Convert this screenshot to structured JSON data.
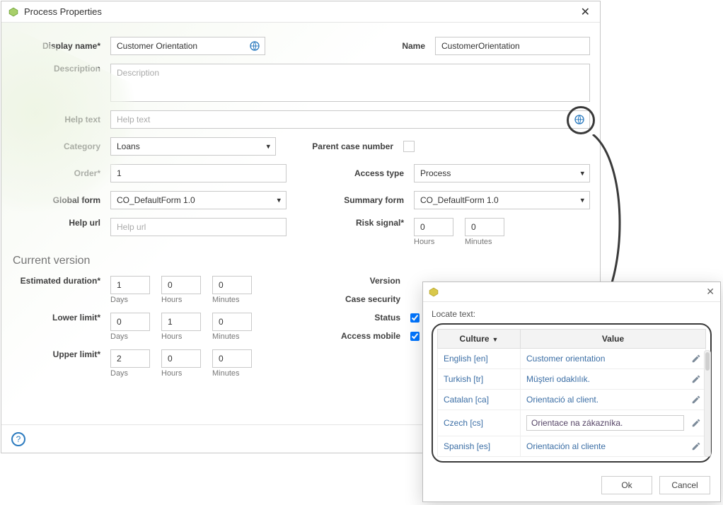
{
  "window": {
    "title": "Process Properties",
    "close_glyph": "✕"
  },
  "labels": {
    "display_name": "Display name*",
    "name": "Name",
    "description": "Description",
    "help_text": "Help text",
    "category": "Category",
    "parent_case": "Parent case number",
    "order": "Order*",
    "access_type": "Access type",
    "global_form": "Global form",
    "summary_form": "Summary form",
    "help_url": "Help url",
    "risk_signal": "Risk signal*",
    "hours": "Hours",
    "minutes": "Minutes",
    "days": "Days",
    "section_current_version": "Current version",
    "est_duration": "Estimated duration*",
    "lower_limit": "Lower limit*",
    "upper_limit": "Upper limit*",
    "version": "Version",
    "case_security": "Case security",
    "status": "Status",
    "access_mobile": "Access mobile"
  },
  "values": {
    "display_name": "Customer Orientation",
    "name": "CustomerOrientation",
    "description_ph": "Description",
    "help_text_ph": "Help text",
    "category": "Loans",
    "order": "1",
    "access_type": "Process",
    "global_form": "CO_DefaultForm 1.0",
    "summary_form": "CO_DefaultForm 1.0",
    "help_url_ph": "Help url",
    "risk_hours": "0",
    "risk_minutes": "0",
    "est_days": "1",
    "est_hours": "0",
    "est_minutes": "0",
    "low_days": "0",
    "low_hours": "1",
    "low_minutes": "0",
    "up_days": "2",
    "up_hours": "0",
    "up_minutes": "0",
    "status_checked": true,
    "mobile_checked": true
  },
  "popup": {
    "locate_label": "Locate text:",
    "col_culture": "Culture",
    "col_value": "Value",
    "rows": [
      {
        "culture": "English [en]",
        "value": "Customer orientation",
        "editing": false
      },
      {
        "culture": "Turkish [tr]",
        "value": "Müşteri odaklılık.",
        "editing": false
      },
      {
        "culture": "Catalan [ca]",
        "value": "Orientació al client.",
        "editing": false
      },
      {
        "culture": "Czech [cs]",
        "value": "Orientace na zákazníka.",
        "editing": true
      },
      {
        "culture": "Spanish [es]",
        "value": "Orientación al cliente",
        "editing": false
      }
    ],
    "ok": "Ok",
    "cancel": "Cancel"
  }
}
